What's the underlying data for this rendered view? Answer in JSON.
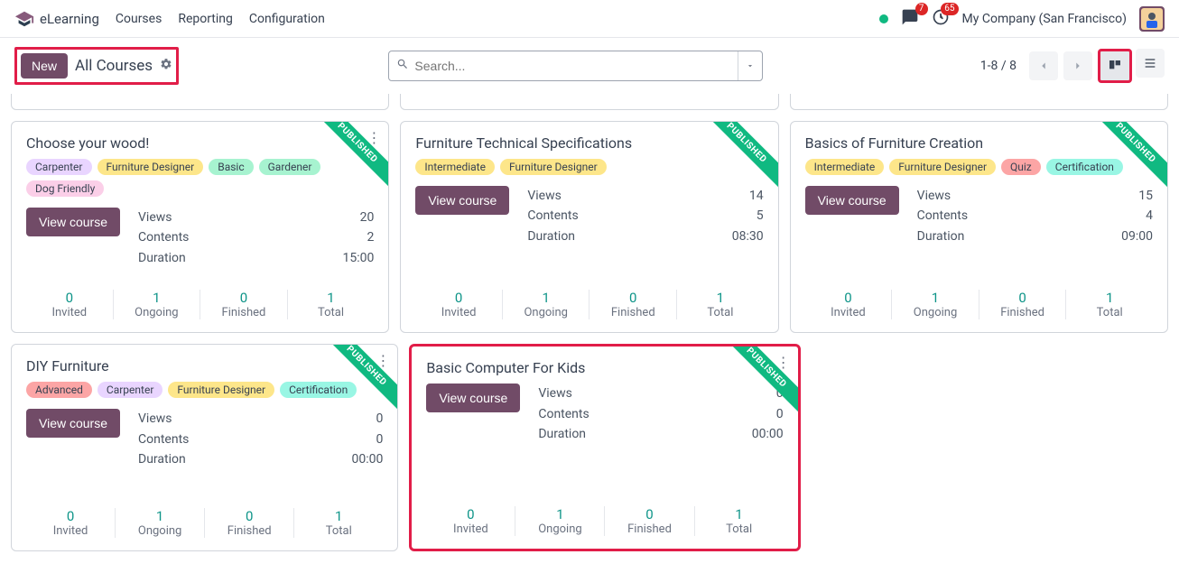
{
  "nav": {
    "app": "eLearning",
    "links": [
      "Courses",
      "Reporting",
      "Configuration"
    ],
    "msg_badge": "7",
    "activity_badge": "65",
    "company": "My Company (San Francisco)"
  },
  "toolbar": {
    "new": "New",
    "title": "All Courses",
    "search_placeholder": "Search...",
    "pager": "1-8 / 8"
  },
  "tag_colors": {
    "Carpenter": "#e9d5ff",
    "Furniture Designer": "#fde68a",
    "Basic": "#a7f3d0",
    "Gardener": "#a7f3d0",
    "Dog Friendly": "#fbcfe8",
    "Intermediate": "#fde68a",
    "Quiz": "#fca5a5",
    "Certification": "#99f6e4",
    "Advanced": "#fca5a5"
  },
  "footer_labels": [
    "Invited",
    "Ongoing",
    "Finished",
    "Total"
  ],
  "stat_labels": [
    "Views",
    "Contents",
    "Duration"
  ],
  "view_btn": "View course",
  "ribbon": "PUBLISHED",
  "rows": [
    [
      {
        "title": "Choose your wood!",
        "tags": [
          "Carpenter",
          "Furniture Designer",
          "Basic",
          "Gardener",
          "Dog Friendly"
        ],
        "stats": [
          "20",
          "2",
          "15:00"
        ],
        "footer": [
          "0",
          "1",
          "0",
          "1"
        ],
        "highlight": false,
        "menu": true
      },
      {
        "title": "Furniture Technical Specifications",
        "tags": [
          "Intermediate",
          "Furniture Designer"
        ],
        "stats": [
          "14",
          "5",
          "08:30"
        ],
        "footer": [
          "0",
          "1",
          "0",
          "1"
        ],
        "highlight": false,
        "menu": false
      },
      {
        "title": "Basics of Furniture Creation",
        "tags": [
          "Intermediate",
          "Furniture Designer",
          "Quiz",
          "Certification"
        ],
        "stats": [
          "15",
          "4",
          "09:00"
        ],
        "footer": [
          "0",
          "1",
          "0",
          "1"
        ],
        "highlight": false,
        "menu": false
      }
    ],
    [
      {
        "title": "DIY Furniture",
        "tags": [
          "Advanced",
          "Carpenter",
          "Furniture Designer",
          "Certification"
        ],
        "stats": [
          "0",
          "0",
          "00:00"
        ],
        "footer": [
          "0",
          "1",
          "0",
          "1"
        ],
        "highlight": false,
        "menu": true
      },
      {
        "title": "Basic Computer For Kids",
        "tags": [],
        "stats": [
          "0",
          "0",
          "00:00"
        ],
        "footer": [
          "0",
          "1",
          "0",
          "1"
        ],
        "highlight": true,
        "menu": true
      },
      null
    ]
  ]
}
